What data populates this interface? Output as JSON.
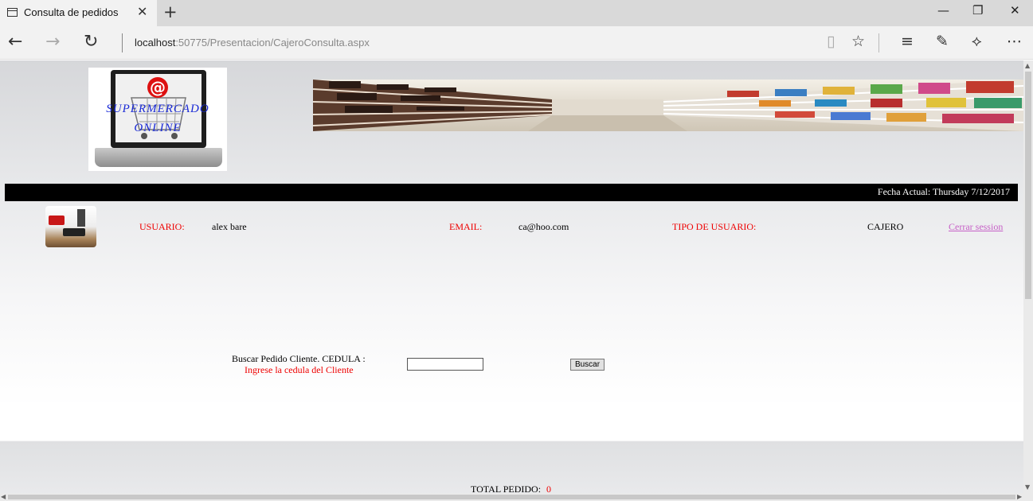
{
  "browser": {
    "tab_title": "Consulta de pedidos",
    "new_tab": "+",
    "url_host": "localhost",
    "url_path": ":50775/Presentacion/CajeroConsulta.aspx"
  },
  "page": {
    "logo_line1": "SUPERMERCADO",
    "logo_line2": "ONLINE",
    "date_label": "Fecha Actual:  Thursday 7/12/2017",
    "user": {
      "usuario_label": "USUARIO:",
      "usuario_value": "alex bare",
      "email_label": "EMAIL:",
      "email_value": "ca@hoo.com",
      "tipo_label": "TIPO DE USUARIO:",
      "tipo_value": "CAJERO",
      "logout_label": "Cerrar session"
    },
    "search": {
      "label": "Buscar Pedido Cliente. CEDULA :",
      "hint": "Ingrese la cedula del Cliente",
      "input_value": "",
      "button_label": "Buscar"
    },
    "total": {
      "label": "TOTAL PEDIDO:",
      "value": "0"
    }
  },
  "colors": {
    "label_red": "#e00000",
    "link_visited": "#c660c6",
    "logo_blue": "#1a2ad6",
    "date_bar": "#000000"
  },
  "icons": [
    "page-icon",
    "close-icon",
    "back-icon",
    "forward-icon",
    "refresh-icon",
    "reading-view-icon",
    "favorite-star-icon",
    "hub-icon",
    "web-note-icon",
    "share-icon",
    "more-icon"
  ]
}
